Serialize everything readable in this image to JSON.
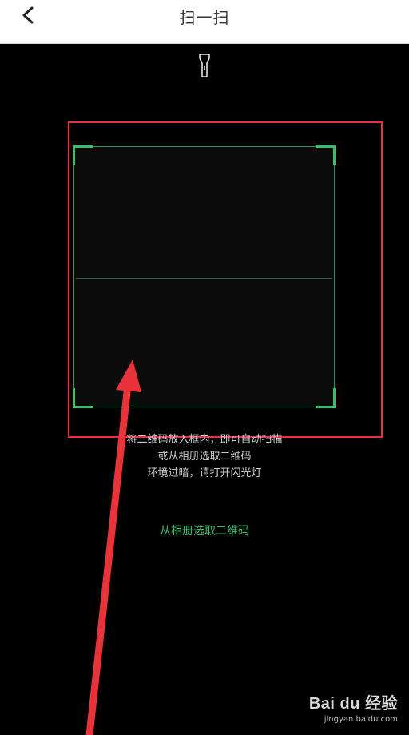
{
  "header": {
    "title": "扫一扫"
  },
  "icons": {
    "back": "chevron-left-icon",
    "torch": "flashlight-icon"
  },
  "hints": {
    "line1": "将二维码放入框内，即可自动扫描",
    "line2": "或从相册选取二维码",
    "line3": "环境过暗，请打开闪光灯"
  },
  "album_link": "从相册选取二维码",
  "watermark": {
    "brand": "Bai du 经验",
    "url": "jingyan.baidu.com"
  },
  "colors": {
    "accent": "#3fbf6e",
    "highlight": "#e8333a",
    "background": "#000000",
    "header": "#ffffff"
  }
}
